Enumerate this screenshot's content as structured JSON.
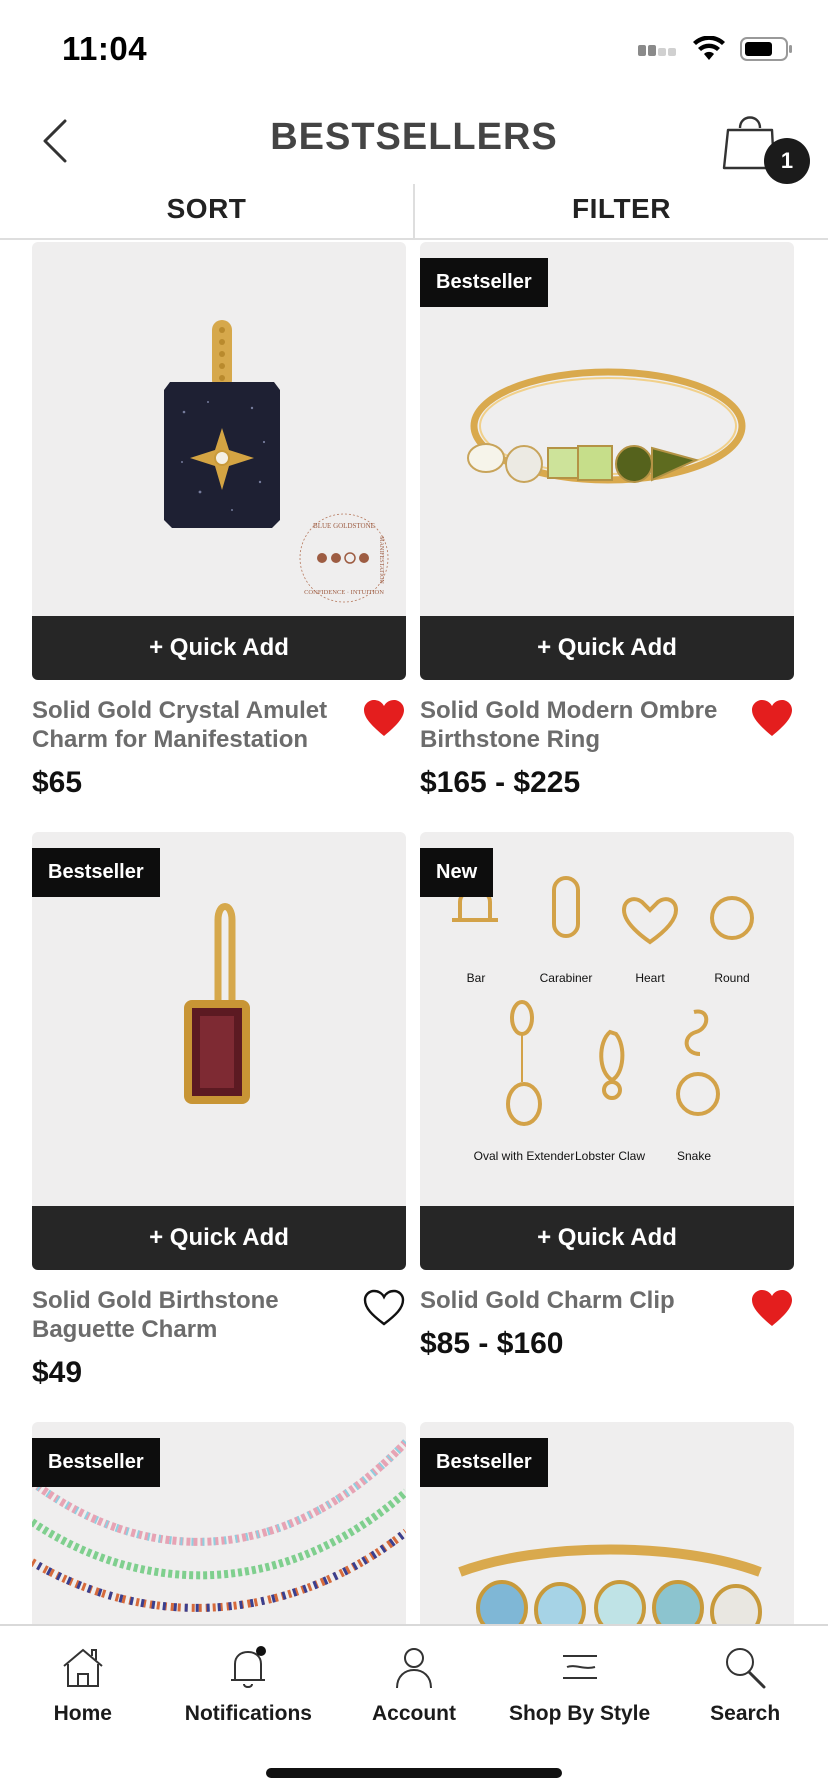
{
  "status_bar": {
    "time": "11:04"
  },
  "header": {
    "title": "BESTSELLERS",
    "cart_count": "1"
  },
  "toolbar": {
    "sort_label": "SORT",
    "filter_label": "FILTER"
  },
  "quick_add_label": "+ Quick Add",
  "products": [
    {
      "name": "Solid Gold Crystal Amulet Charm for Manifestation",
      "price": "$65",
      "badge": "",
      "favorited": true,
      "stamp_lines": [
        "BLUE GOLDSTONE",
        "CONFIDENCE · INTUITION",
        "MANIFESTATION"
      ]
    },
    {
      "name": "Solid Gold Modern Ombre Birthstone Ring",
      "price": "$165 - $225",
      "badge": "Bestseller",
      "favorited": true
    },
    {
      "name": "Solid Gold Birthstone Baguette Charm",
      "price": "$49",
      "badge": "Bestseller",
      "favorited": false
    },
    {
      "name": "Solid Gold Charm Clip",
      "price": "$85 - $160",
      "badge": "New",
      "favorited": true,
      "clip_types": [
        "Bar",
        "Carabiner",
        "Heart",
        "Round",
        "Oval with Extender",
        "Lobster Claw",
        "Snake"
      ]
    },
    {
      "name": "",
      "price": "",
      "badge": "Bestseller",
      "favorited": false
    },
    {
      "name": "",
      "price": "",
      "badge": "Bestseller",
      "favorited": false
    }
  ],
  "tab_bar": {
    "items": [
      {
        "label": "Home",
        "icon": "home-icon"
      },
      {
        "label": "Notifications",
        "icon": "bell-icon"
      },
      {
        "label": "Account",
        "icon": "person-icon"
      },
      {
        "label": "Shop By Style",
        "icon": "menu-lines-icon"
      },
      {
        "label": "Search",
        "icon": "search-icon"
      }
    ]
  },
  "colors": {
    "heart_red": "#e41e1e",
    "badge_bg": "#0d0d0d",
    "quick_add_bg": "#262626",
    "product_name": "#6c6c6c"
  }
}
